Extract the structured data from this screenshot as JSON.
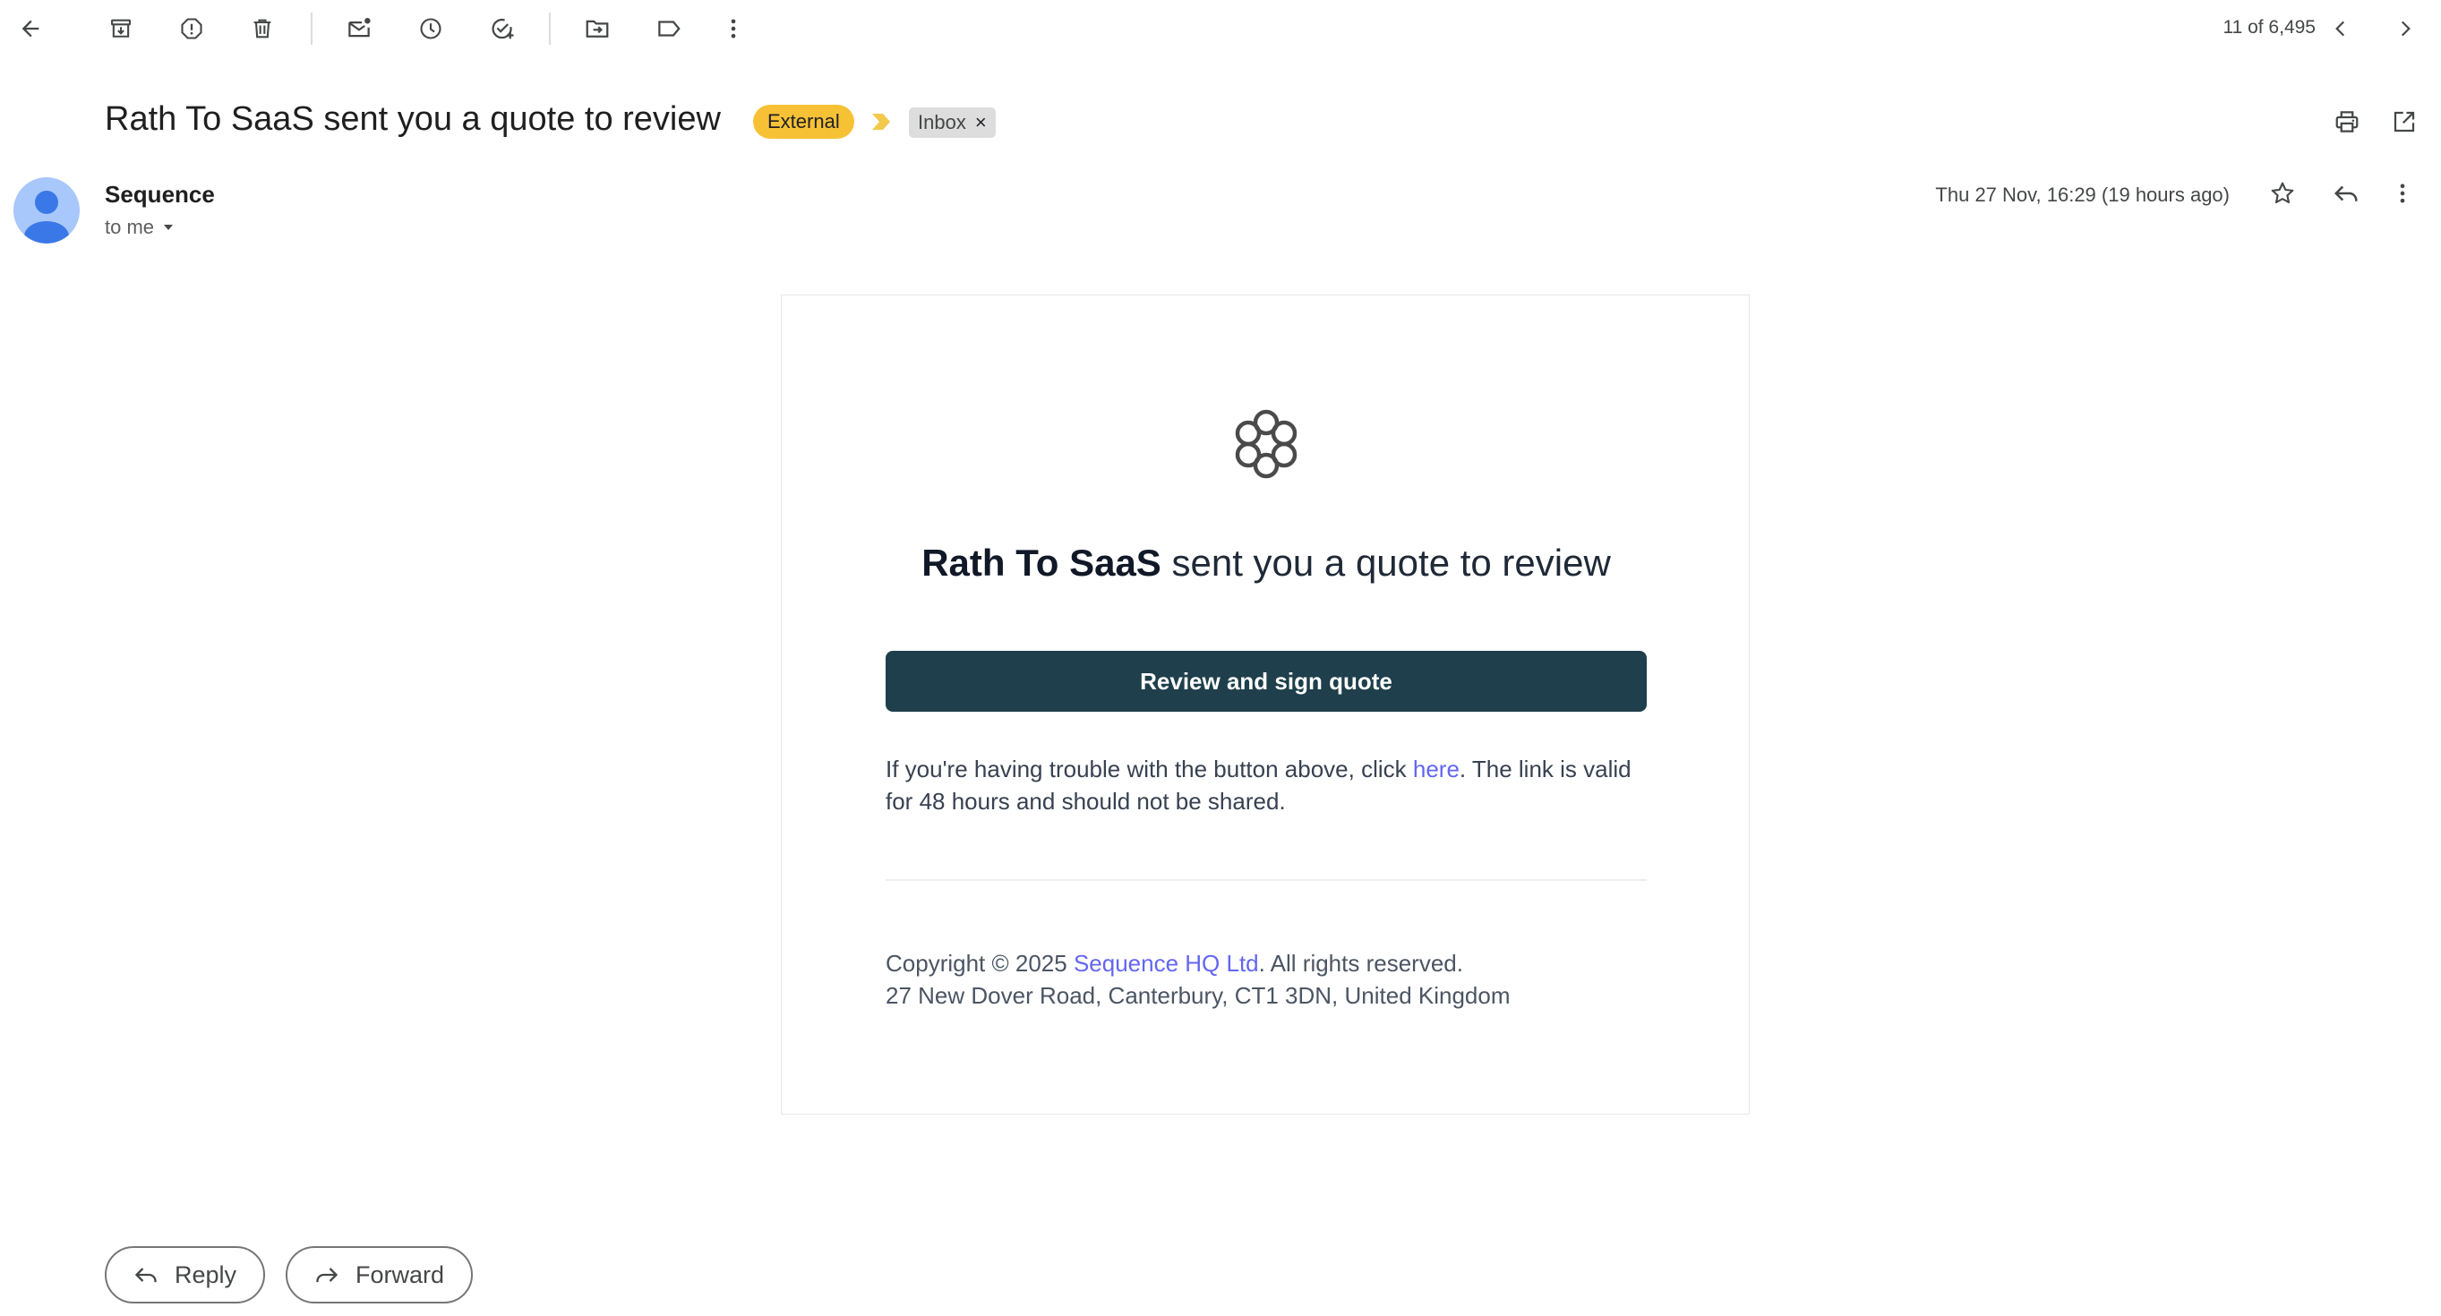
{
  "toolbar": {
    "counter": "11 of 6,495"
  },
  "subject": {
    "title": "Rath To SaaS sent you a quote to review",
    "label_external": "External",
    "label_inbox": "Inbox",
    "label_inbox_remove": "×"
  },
  "sender": {
    "name": "Sequence",
    "to": "to me",
    "date": "Thu 27 Nov, 16:29 (19 hours ago)"
  },
  "email": {
    "heading_bold": "Rath To SaaS",
    "heading_rest": " sent you a quote to review",
    "cta_label": "Review and sign quote",
    "trouble_prefix": "If you're having trouble with the button above, click ",
    "trouble_link": "here",
    "trouble_suffix": ". The link is valid for 48 hours and should not be shared.",
    "copyright_prefix": "Copyright © 2025 ",
    "copyright_link": "Sequence HQ Ltd",
    "copyright_suffix": ". All rights reserved.",
    "address": "27 New Dover Road, Canterbury, CT1 3DN, United Kingdom"
  },
  "actions": {
    "reply": "Reply",
    "forward": "Forward"
  },
  "colors": {
    "external_label": "#f7c136",
    "cta_background": "#1e3f4b",
    "link": "#6366f1",
    "avatar": "#a8c7fa"
  },
  "icons": [
    "back-arrow-icon",
    "archive-icon",
    "report-spam-icon",
    "delete-icon",
    "mark-unread-icon",
    "snooze-icon",
    "add-task-icon",
    "move-to-icon",
    "label-icon",
    "more-vert-icon",
    "chevron-left-icon",
    "chevron-right-icon",
    "print-icon",
    "open-new-window-icon",
    "star-icon",
    "reply-icon",
    "caret-down-icon",
    "sequence-logo-icon",
    "forward-icon",
    "importance-marker-icon"
  ]
}
